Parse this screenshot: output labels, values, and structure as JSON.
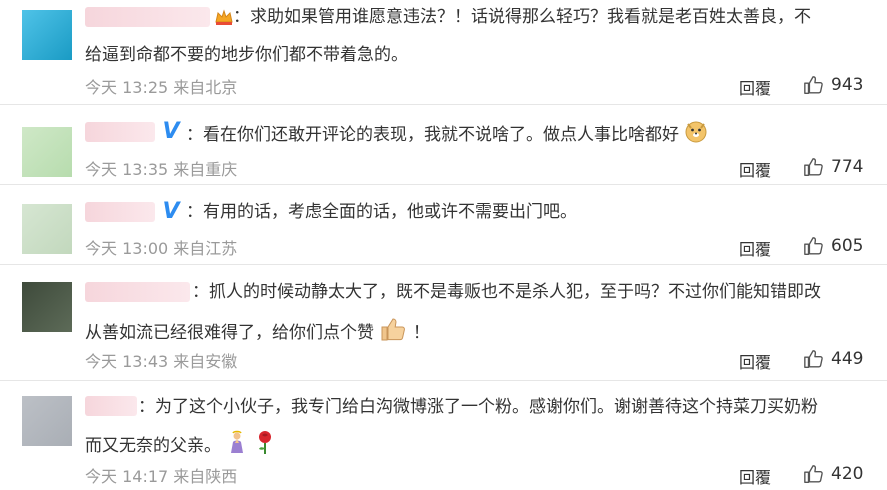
{
  "comments": [
    {
      "badge": "crown-badge",
      "text_line1": "：求助如果管用谁愿意违法？！话说得那么轻巧？我看就是老百姓太善良，不",
      "text_line2": "给逼到命都不要的地步你们都不带着急的。",
      "time": "今天 13:25",
      "location": "来自北京",
      "reply_label": "回覆",
      "likes": "943"
    },
    {
      "badge": "verified-v-badge",
      "text_line1": "：看在你们还敢开评论的表现，我就不说啥了。做点人事比啥都好",
      "emoji": "doge-emoji",
      "time": "今天 13:35",
      "location": "来自重庆",
      "reply_label": "回覆",
      "likes": "774"
    },
    {
      "badge": "verified-v-badge",
      "text_line1": "：有用的话，考虑全面的话，他或许不需要出门吧。",
      "time": "今天 13:00",
      "location": "来自江苏",
      "reply_label": "回覆",
      "likes": "605"
    },
    {
      "text_line1": "：抓人的时候动静太大了，既不是毒贩也不是杀人犯，至于吗？不过你们能知错即改",
      "text_line2": "从善如流已经很难得了，给你们点个赞",
      "text_line2_tail": "！",
      "emoji": "thumbs-up-emoji",
      "time": "今天 13:43",
      "location": "来自安徽",
      "reply_label": "回覆",
      "likes": "449"
    },
    {
      "text_line1": "：为了这个小伙子，我专门给白沟微博涨了一个粉。感谢你们。谢谢善待这个持菜刀买奶粉",
      "text_line2": "而又无奈的父亲。",
      "emoji": "pray-emoji",
      "emoji2": "rose-emoji",
      "time": "今天 14:17",
      "location": "来自陕西",
      "reply_label": "回覆",
      "likes": "420"
    }
  ],
  "colors": {
    "verified_blue": "#2d8cf0",
    "meta_gray": "#9a9a9a",
    "divider": "#e6e6e6"
  }
}
